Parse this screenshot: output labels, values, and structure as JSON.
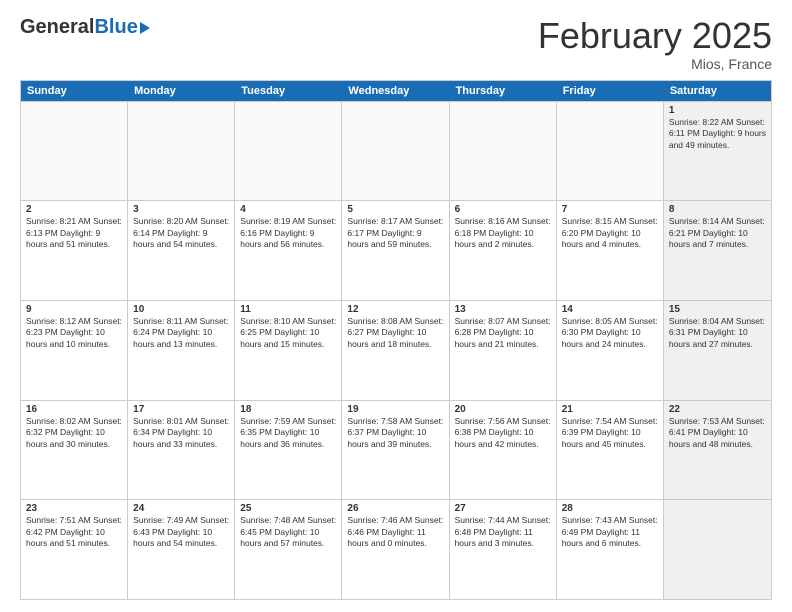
{
  "header": {
    "logo_general": "General",
    "logo_blue": "Blue",
    "month_title": "February 2025",
    "location": "Mios, France"
  },
  "days_of_week": [
    "Sunday",
    "Monday",
    "Tuesday",
    "Wednesday",
    "Thursday",
    "Friday",
    "Saturday"
  ],
  "rows": [
    {
      "cells": [
        {
          "day": "",
          "info": "",
          "shaded": false,
          "empty": true
        },
        {
          "day": "",
          "info": "",
          "shaded": false,
          "empty": true
        },
        {
          "day": "",
          "info": "",
          "shaded": false,
          "empty": true
        },
        {
          "day": "",
          "info": "",
          "shaded": false,
          "empty": true
        },
        {
          "day": "",
          "info": "",
          "shaded": false,
          "empty": true
        },
        {
          "day": "",
          "info": "",
          "shaded": false,
          "empty": true
        },
        {
          "day": "1",
          "info": "Sunrise: 8:22 AM\nSunset: 6:11 PM\nDaylight: 9 hours and 49 minutes.",
          "shaded": true,
          "empty": false
        }
      ]
    },
    {
      "cells": [
        {
          "day": "2",
          "info": "Sunrise: 8:21 AM\nSunset: 6:13 PM\nDaylight: 9 hours and 51 minutes.",
          "shaded": false,
          "empty": false
        },
        {
          "day": "3",
          "info": "Sunrise: 8:20 AM\nSunset: 6:14 PM\nDaylight: 9 hours and 54 minutes.",
          "shaded": false,
          "empty": false
        },
        {
          "day": "4",
          "info": "Sunrise: 8:19 AM\nSunset: 6:16 PM\nDaylight: 9 hours and 56 minutes.",
          "shaded": false,
          "empty": false
        },
        {
          "day": "5",
          "info": "Sunrise: 8:17 AM\nSunset: 6:17 PM\nDaylight: 9 hours and 59 minutes.",
          "shaded": false,
          "empty": false
        },
        {
          "day": "6",
          "info": "Sunrise: 8:16 AM\nSunset: 6:18 PM\nDaylight: 10 hours and 2 minutes.",
          "shaded": false,
          "empty": false
        },
        {
          "day": "7",
          "info": "Sunrise: 8:15 AM\nSunset: 6:20 PM\nDaylight: 10 hours and 4 minutes.",
          "shaded": false,
          "empty": false
        },
        {
          "day": "8",
          "info": "Sunrise: 8:14 AM\nSunset: 6:21 PM\nDaylight: 10 hours and 7 minutes.",
          "shaded": true,
          "empty": false
        }
      ]
    },
    {
      "cells": [
        {
          "day": "9",
          "info": "Sunrise: 8:12 AM\nSunset: 6:23 PM\nDaylight: 10 hours and 10 minutes.",
          "shaded": false,
          "empty": false
        },
        {
          "day": "10",
          "info": "Sunrise: 8:11 AM\nSunset: 6:24 PM\nDaylight: 10 hours and 13 minutes.",
          "shaded": false,
          "empty": false
        },
        {
          "day": "11",
          "info": "Sunrise: 8:10 AM\nSunset: 6:25 PM\nDaylight: 10 hours and 15 minutes.",
          "shaded": false,
          "empty": false
        },
        {
          "day": "12",
          "info": "Sunrise: 8:08 AM\nSunset: 6:27 PM\nDaylight: 10 hours and 18 minutes.",
          "shaded": false,
          "empty": false
        },
        {
          "day": "13",
          "info": "Sunrise: 8:07 AM\nSunset: 6:28 PM\nDaylight: 10 hours and 21 minutes.",
          "shaded": false,
          "empty": false
        },
        {
          "day": "14",
          "info": "Sunrise: 8:05 AM\nSunset: 6:30 PM\nDaylight: 10 hours and 24 minutes.",
          "shaded": false,
          "empty": false
        },
        {
          "day": "15",
          "info": "Sunrise: 8:04 AM\nSunset: 6:31 PM\nDaylight: 10 hours and 27 minutes.",
          "shaded": true,
          "empty": false
        }
      ]
    },
    {
      "cells": [
        {
          "day": "16",
          "info": "Sunrise: 8:02 AM\nSunset: 6:32 PM\nDaylight: 10 hours and 30 minutes.",
          "shaded": false,
          "empty": false
        },
        {
          "day": "17",
          "info": "Sunrise: 8:01 AM\nSunset: 6:34 PM\nDaylight: 10 hours and 33 minutes.",
          "shaded": false,
          "empty": false
        },
        {
          "day": "18",
          "info": "Sunrise: 7:59 AM\nSunset: 6:35 PM\nDaylight: 10 hours and 36 minutes.",
          "shaded": false,
          "empty": false
        },
        {
          "day": "19",
          "info": "Sunrise: 7:58 AM\nSunset: 6:37 PM\nDaylight: 10 hours and 39 minutes.",
          "shaded": false,
          "empty": false
        },
        {
          "day": "20",
          "info": "Sunrise: 7:56 AM\nSunset: 6:38 PM\nDaylight: 10 hours and 42 minutes.",
          "shaded": false,
          "empty": false
        },
        {
          "day": "21",
          "info": "Sunrise: 7:54 AM\nSunset: 6:39 PM\nDaylight: 10 hours and 45 minutes.",
          "shaded": false,
          "empty": false
        },
        {
          "day": "22",
          "info": "Sunrise: 7:53 AM\nSunset: 6:41 PM\nDaylight: 10 hours and 48 minutes.",
          "shaded": true,
          "empty": false
        }
      ]
    },
    {
      "cells": [
        {
          "day": "23",
          "info": "Sunrise: 7:51 AM\nSunset: 6:42 PM\nDaylight: 10 hours and 51 minutes.",
          "shaded": false,
          "empty": false
        },
        {
          "day": "24",
          "info": "Sunrise: 7:49 AM\nSunset: 6:43 PM\nDaylight: 10 hours and 54 minutes.",
          "shaded": false,
          "empty": false
        },
        {
          "day": "25",
          "info": "Sunrise: 7:48 AM\nSunset: 6:45 PM\nDaylight: 10 hours and 57 minutes.",
          "shaded": false,
          "empty": false
        },
        {
          "day": "26",
          "info": "Sunrise: 7:46 AM\nSunset: 6:46 PM\nDaylight: 11 hours and 0 minutes.",
          "shaded": false,
          "empty": false
        },
        {
          "day": "27",
          "info": "Sunrise: 7:44 AM\nSunset: 6:48 PM\nDaylight: 11 hours and 3 minutes.",
          "shaded": false,
          "empty": false
        },
        {
          "day": "28",
          "info": "Sunrise: 7:43 AM\nSunset: 6:49 PM\nDaylight: 11 hours and 6 minutes.",
          "shaded": false,
          "empty": false
        },
        {
          "day": "",
          "info": "",
          "shaded": true,
          "empty": true
        }
      ]
    }
  ]
}
